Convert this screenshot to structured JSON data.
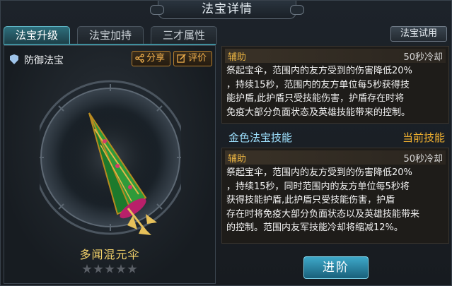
{
  "title": "法宝详情",
  "tabs": [
    {
      "label": "法宝升级",
      "active": true
    },
    {
      "label": "法宝加持",
      "active": false
    },
    {
      "label": "三才属性",
      "active": false
    }
  ],
  "left": {
    "type_label": "防御法宝",
    "share_label": "分享",
    "review_label": "评价",
    "item_name": "多闻混元伞",
    "stars_total": 5,
    "stars_filled": 0
  },
  "right": {
    "try_label": "法宝试用",
    "skill1": {
      "tag": "辅助",
      "cooldown": "50秒冷却",
      "desc_lines": [
        "祭起宝伞，范围内的友方受到的伤害降低20%",
        "，持续15秒，范围内的友方单位每5秒获得技",
        "能护盾,此护盾只受技能伤害，护盾存在时将",
        "免疫大部分负面状态及英雄技能带来的控制。"
      ]
    },
    "gold_title": "金色法宝技能",
    "gold_current": "当前技能",
    "skill2": {
      "tag": "辅助",
      "cooldown": "50秒冷却",
      "desc_lines": [
        "祭起宝伞，范围内的友方受到的伤害降低20%",
        "，持续15秒，同时范围内的友方单位每5秒将",
        "获得技能护盾,此护盾只受技能伤害，护盾",
        "存在时将免疫大部分负面状态以及英雄技能带来",
        "的控制。范围内友军技能冷却将缩减12%。"
      ]
    },
    "advance_label": "进阶"
  },
  "colors": {
    "accent_teal": "#3f8f9d",
    "gold": "#f3d26a",
    "orange": "#f0b030",
    "cyan_text": "#9ee1ff"
  }
}
